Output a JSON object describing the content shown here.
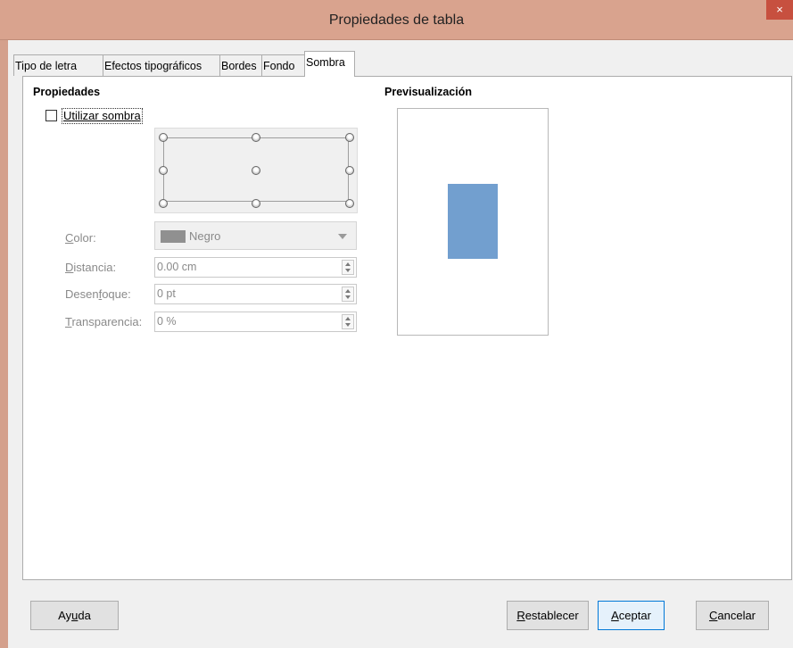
{
  "window": {
    "title": "Propiedades de tabla",
    "close_glyph": "×"
  },
  "tabs": [
    {
      "label": "Tipo de letra",
      "active": false
    },
    {
      "label": "Efectos tipográficos",
      "active": false
    },
    {
      "label": "Bordes",
      "active": false
    },
    {
      "label": "Fondo",
      "active": false
    },
    {
      "label": "Sombra",
      "active": true
    }
  ],
  "properties": {
    "heading": "Propiedades",
    "use_shadow": {
      "label": "Utilizar sombra",
      "checked": false
    },
    "color": {
      "label_prefix": "",
      "label_u": "C",
      "label_rest": "olor:",
      "value": "Negro",
      "swatch": "#909090"
    },
    "distance": {
      "label_u": "D",
      "label_rest": "istancia:",
      "value": "0.00 cm"
    },
    "blur": {
      "label_pre": "Desen",
      "label_u": "f",
      "label_rest": "oque:",
      "value": "0 pt"
    },
    "transparency": {
      "label_u": "T",
      "label_rest": "ransparencia:",
      "value": "0 %"
    }
  },
  "preview": {
    "heading": "Previsualización",
    "table_color": "#729fcf"
  },
  "buttons": {
    "help": {
      "pre": "Ay",
      "u": "u",
      "post": "da"
    },
    "reset": {
      "pre": "",
      "u": "R",
      "post": "establecer"
    },
    "ok": {
      "pre": "",
      "u": "A",
      "post": "ceptar"
    },
    "cancel": {
      "pre": "",
      "u": "C",
      "post": "ancelar"
    }
  },
  "colors": {
    "titlebar": "#d9a38e",
    "dialog_bg": "#f0f0f0",
    "accent": "#0078d7"
  }
}
